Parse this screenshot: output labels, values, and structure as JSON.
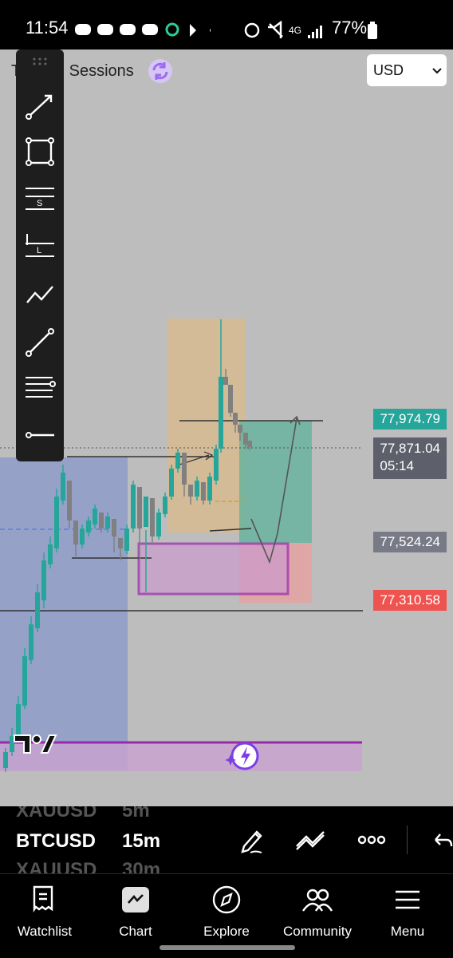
{
  "status_bar": {
    "time": "11:54",
    "battery": "77%"
  },
  "header": {
    "title": "Trading Sessions",
    "currency": "USD"
  },
  "price_labels": {
    "target": "77,974.79",
    "current_price": "77,871.04",
    "countdown": "05:14",
    "level_mid": "77,524.24",
    "stop": "77,310.58"
  },
  "colors": {
    "target": "#26a69a",
    "current": "#5d606b",
    "stop": "#ef5350",
    "purple": "#9c27b0",
    "candle_up": "#26a69a",
    "candle_down": "#808080"
  },
  "symbol_strip": {
    "prev_symbol": "XAUUSD",
    "prev_interval": "5m",
    "symbol": "BTCUSD",
    "interval": "15m",
    "next_symbol": "XAUUSD",
    "next_interval": "30m"
  },
  "toolbar_icons": [
    "trend-line-arrow-icon",
    "rectangle-icon",
    "short-position-icon",
    "long-position-icon",
    "path-icon",
    "line-icon",
    "fib-lines-icon",
    "horizontal-ray-icon"
  ],
  "bottom_nav": [
    {
      "label": "Watchlist",
      "icon": "watchlist-icon"
    },
    {
      "label": "Chart",
      "icon": "chart-icon"
    },
    {
      "label": "Explore",
      "icon": "compass-icon"
    },
    {
      "label": "Community",
      "icon": "community-icon"
    },
    {
      "label": "Menu",
      "icon": "menu-icon"
    }
  ]
}
